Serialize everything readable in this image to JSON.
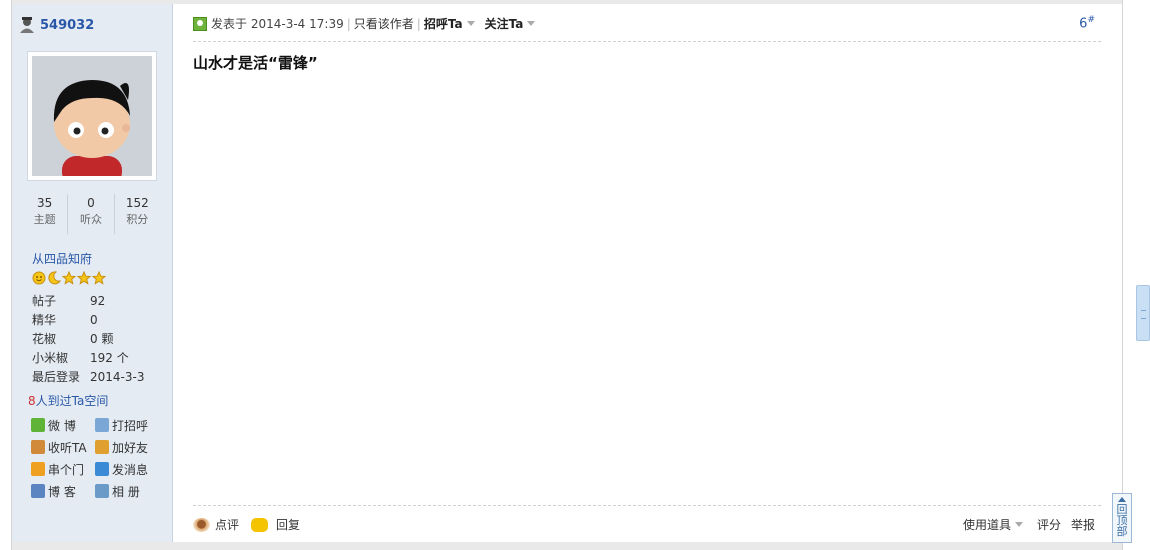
{
  "user": {
    "name": "549032",
    "stats": [
      {
        "value": "35",
        "label": "主题"
      },
      {
        "value": "0",
        "label": "听众"
      },
      {
        "value": "152",
        "label": "积分"
      }
    ],
    "rank_title": "从四品知府",
    "info": [
      {
        "key": "帖子",
        "value": "92"
      },
      {
        "key": "精华",
        "value": "0"
      },
      {
        "key": "花椒",
        "value": "0 颗"
      },
      {
        "key": "小米椒",
        "value": "192 个"
      },
      {
        "key": "最后登录",
        "value": "2014-3-3"
      }
    ],
    "visits_count": "8",
    "visits_text": "人到过Ta空间",
    "actions": [
      {
        "label": "微 博",
        "icon": "weibo-icon",
        "color": "#5fb336"
      },
      {
        "label": "打招呼",
        "icon": "greet-icon",
        "color": "#7aa7d6"
      },
      {
        "label": "收听TA",
        "icon": "follow-icon",
        "color": "#d08a3a"
      },
      {
        "label": "加好友",
        "icon": "add-friend-icon",
        "color": "#e0a030"
      },
      {
        "label": "串个门",
        "icon": "home-icon",
        "color": "#f0a020"
      },
      {
        "label": "发消息",
        "icon": "message-icon",
        "color": "#3a8ad6"
      },
      {
        "label": "博 客",
        "icon": "blog-icon",
        "color": "#5a85c0"
      },
      {
        "label": "相 册",
        "icon": "album-icon",
        "color": "#6a9ac8"
      }
    ]
  },
  "post": {
    "meta_prefix": "发表于",
    "datetime": "2014-3-4 17:39",
    "only_author": "只看该作者",
    "greet": "招呼Ta",
    "follow": "关注Ta",
    "floor": "6",
    "floor_mark": "#",
    "body": "山水才是活“雷锋”"
  },
  "footer": {
    "comment": "点评",
    "reply": "回复",
    "tools": "使用道具",
    "rate": "评分",
    "report": "举报"
  },
  "back_to_top": "回顶部",
  "colors": {
    "sidebar_bg": "#e4ebf3",
    "link_blue": "#2a58a8",
    "visit_red": "#c33"
  }
}
